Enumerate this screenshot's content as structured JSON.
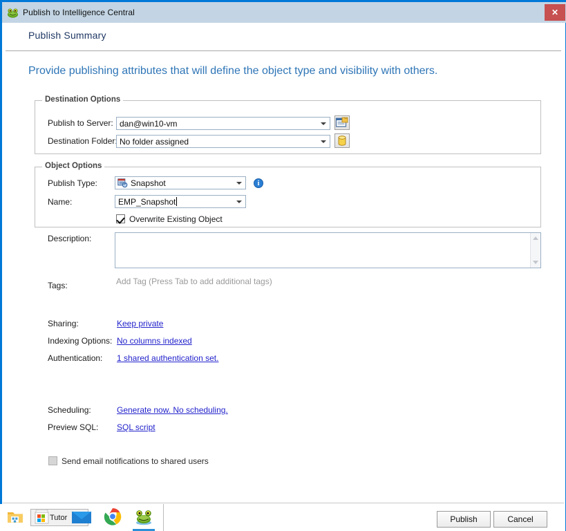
{
  "window": {
    "title": "Publish to Intelligence Central",
    "app_icon": "frog-icon",
    "close_label": "✕"
  },
  "header": {
    "page_title": "Publish Summary",
    "intro": "Provide publishing attributes that will define the object type and visibility with others."
  },
  "destination_options": {
    "legend": "Destination Options",
    "server": {
      "label": "Publish to Server:",
      "value": "dan@win10-vm",
      "button_icon": "server-properties-icon"
    },
    "folder": {
      "label": "Destination Folder:",
      "value": "No folder assigned",
      "button_icon": "database-cylinder-icon"
    }
  },
  "object_options": {
    "legend": "Object Options",
    "publish_type": {
      "label": "Publish Type:",
      "value": "Snapshot",
      "inner_icon": "snapshot-icon",
      "info_icon": "info-icon",
      "info_glyph": "i"
    },
    "name": {
      "label": "Name:",
      "value": "EMP_Snapshot"
    },
    "overwrite": {
      "label": "Overwrite Existing Object",
      "checked": true
    }
  },
  "description": {
    "label": "Description:",
    "value": "",
    "scroll_up_icon": "scroll-up-arrow-icon",
    "scroll_down_icon": "scroll-down-arrow-icon"
  },
  "tags": {
    "label": "Tags:",
    "placeholder": "Add Tag (Press Tab to add additional tags)",
    "value": ""
  },
  "options_links": [
    {
      "label": "Sharing:",
      "link": "Keep private",
      "name": "sharing"
    },
    {
      "label": "Indexing Options:",
      "link": "No columns indexed",
      "name": "indexing-options"
    },
    {
      "label": "Authentication:",
      "link": "1 shared authentication set.",
      "name": "authentication"
    }
  ],
  "scheduling": {
    "label": "Scheduling:",
    "link": "Generate now. No scheduling."
  },
  "preview_sql": {
    "label": "Preview SQL:",
    "link": "SQL script"
  },
  "email_notify": {
    "label": "Send email notifications to shared users",
    "checked": false,
    "disabled": true
  },
  "footer": {
    "publish_label": "Publish",
    "cancel_label": "Cancel"
  },
  "taskbar": {
    "items": [
      {
        "name": "file-explorer-icon",
        "label": ""
      },
      {
        "name": "tutorial-window-button",
        "label": "Tutor"
      },
      {
        "name": "mail-envelope-icon",
        "label": ""
      },
      {
        "name": "chrome-icon",
        "label": ""
      },
      {
        "name": "toad-frog-app-icon",
        "label": ""
      }
    ]
  },
  "colors": {
    "titlebar": "#c3d5e4",
    "window_border": "#0078d7",
    "close_button": "#c75050",
    "intro_text": "#2e75b6",
    "page_title": "#1f3864",
    "link": "#2222cc"
  }
}
